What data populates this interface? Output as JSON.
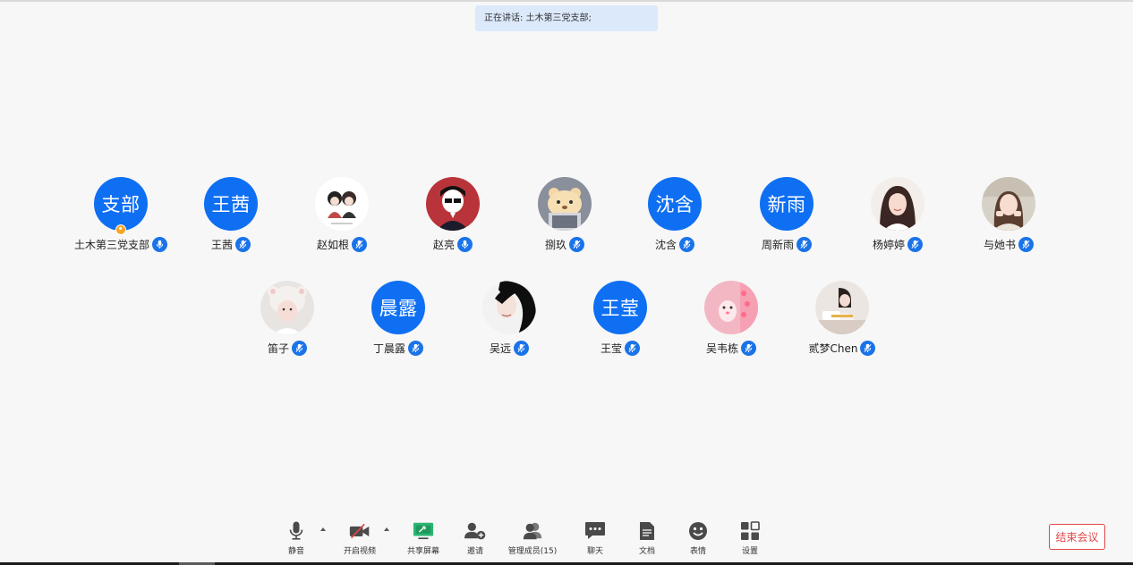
{
  "speaking": {
    "text": "正在讲话: 土木第三党支部;"
  },
  "participants_row1": [
    {
      "name": "土木第三党支部",
      "avatar_text": "支部",
      "avatar_type": "text",
      "host": true,
      "mic": "on"
    },
    {
      "name": "王茜",
      "avatar_text": "王茜",
      "avatar_type": "text",
      "mic": "muted"
    },
    {
      "name": "赵如根",
      "avatar_type": "photo",
      "photo": "couple-drawing",
      "mic": "muted"
    },
    {
      "name": "赵亮",
      "avatar_type": "photo",
      "photo": "cartoon-boy",
      "mic": "on"
    },
    {
      "name": "捌玖",
      "avatar_type": "photo",
      "photo": "bear-drawing",
      "mic": "muted"
    },
    {
      "name": "沈含",
      "avatar_text": "沈含",
      "avatar_type": "text",
      "mic": "muted"
    },
    {
      "name": "周新雨",
      "avatar_text": "新雨",
      "avatar_type": "text",
      "mic": "muted"
    },
    {
      "name": "杨婷婷",
      "avatar_type": "photo",
      "photo": "girl-portrait",
      "mic": "muted"
    },
    {
      "name": "与她书",
      "avatar_type": "photo",
      "photo": "girl-outdoor",
      "mic": "muted"
    }
  ],
  "participants_row2": [
    {
      "name": "笛子",
      "avatar_type": "photo",
      "photo": "girl-hat",
      "mic": "muted"
    },
    {
      "name": "丁晨露",
      "avatar_text": "晨露",
      "avatar_type": "text",
      "mic": "muted"
    },
    {
      "name": "吴远",
      "avatar_type": "photo",
      "photo": "dark-hair",
      "mic": "muted"
    },
    {
      "name": "王莹",
      "avatar_text": "王莹",
      "avatar_type": "text",
      "mic": "muted"
    },
    {
      "name": "吴韦栋",
      "avatar_type": "photo",
      "photo": "pink-toy",
      "mic": "muted"
    },
    {
      "name": "贰梦Chen",
      "avatar_type": "photo",
      "photo": "girl-desk",
      "mic": "muted"
    }
  ],
  "toolbar": {
    "mute": {
      "label": "静音",
      "icon": "microphone-icon"
    },
    "video": {
      "label": "开启视频",
      "icon": "video-off-icon"
    },
    "share": {
      "label": "共享屏幕",
      "icon": "share-screen-icon"
    },
    "invite": {
      "label": "邀请",
      "icon": "add-user-icon"
    },
    "members": {
      "label": "管理成员(15)",
      "icon": "members-icon"
    },
    "chat": {
      "label": "聊天",
      "icon": "chat-icon"
    },
    "docs": {
      "label": "文档",
      "icon": "document-icon"
    },
    "emoji": {
      "label": "表情",
      "icon": "emoji-icon"
    },
    "settings": {
      "label": "设置",
      "icon": "settings-icon"
    },
    "end": {
      "label": "结束会议"
    }
  },
  "colors": {
    "accent": "#0e6ff3",
    "mic_badge": "#1a73e8",
    "end": "#e0484a",
    "host_badge": "#f6a623",
    "share_icon": "#2bb673"
  }
}
